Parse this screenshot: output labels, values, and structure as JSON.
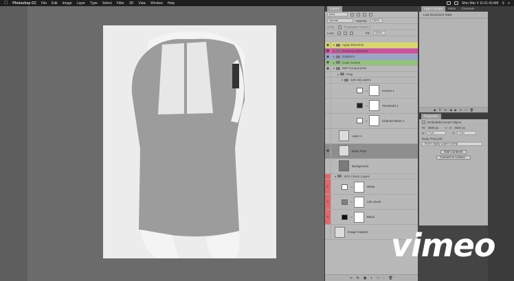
{
  "menubar": {
    "app_name": "Photoshop CC",
    "items": [
      "File",
      "Edit",
      "Image",
      "Layer",
      "Type",
      "Select",
      "Filter",
      "3D",
      "View",
      "Window",
      "Help"
    ],
    "datetime": "Mon Mar 4  11:01:43 AM"
  },
  "layers_panel": {
    "tab": "Layers",
    "filter_kind": "Kind",
    "blend_mode": "Normal",
    "opacity_label": "Opacity:",
    "opacity_value": "100%",
    "lock_label": "Lock:",
    "fill_label": "Fill:",
    "fill_value": "100%",
    "unify_label": "Unify:",
    "propagate_label": "Propagate Frame 1",
    "layers": [
      {
        "name": "Apply Elements",
        "type": "group"
      },
      {
        "name": "Common Elements",
        "type": "group"
      },
      {
        "name": "Graphics",
        "type": "group"
      },
      {
        "name": "Color Curves",
        "type": "group"
      },
      {
        "name": "WIP Components",
        "type": "group"
      },
      {
        "name": "Prep",
        "type": "group"
      },
      {
        "name": "128 Adj Layers",
        "type": "group"
      },
      {
        "name": "Curves 1",
        "type": "adjustment"
      },
      {
        "name": "Threshold 1",
        "type": "adjustment"
      },
      {
        "name": "Channel Mixer 1",
        "type": "adjustment"
      },
      {
        "name": "Layer 1",
        "type": "pixel"
      },
      {
        "name": "Body Prep",
        "type": "pixel"
      },
      {
        "name": "Background",
        "type": "pixel"
      },
      {
        "name": "SPO Check Layers",
        "type": "group"
      },
      {
        "name": "White",
        "type": "fill"
      },
      {
        "name": "128 check",
        "type": "fill"
      },
      {
        "name": "Black",
        "type": "fill"
      },
      {
        "name": "Image Capture",
        "type": "pixel"
      }
    ]
  },
  "layer_comps_panel": {
    "tabs": [
      "Layer Comps",
      "Paths",
      "Channels"
    ],
    "state": "Last Document State"
  },
  "properties_panel": {
    "title": "Properties",
    "object_type": "Embedded Smart Object",
    "w_label": "W:",
    "w_value": "3808 px",
    "h_label": "H:",
    "h_value": "4500 px",
    "x_label": "X:",
    "x_value": "0 px",
    "y_label": "Y:",
    "y_value": "0 px",
    "comp_label": "Body Prep.psb",
    "comp_select": "Don't Apply Layer Comp",
    "edit_button": "Edit Contents",
    "convert_button": "Convert to Linked..."
  },
  "watermark": "vimeo",
  "colors": {
    "red_highlight": "#e06868",
    "yellow_highlight": "#d8d86a",
    "selected_row": "#8e8e8e"
  }
}
